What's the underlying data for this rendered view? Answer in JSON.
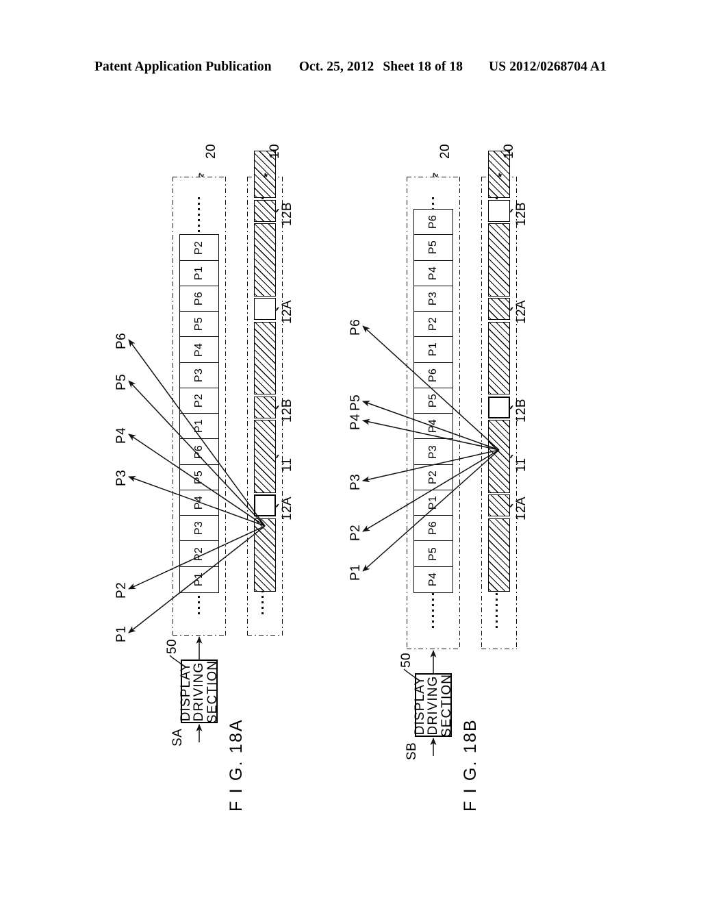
{
  "header": {
    "left": "Patent Application Publication",
    "date": "Oct. 25, 2012",
    "sheet": "Sheet 18 of 18",
    "patent_number": "US 2012/0268704 A1"
  },
  "figures": [
    {
      "id": "fig-18a",
      "name": "F I G.  18A",
      "input_signal": "SA",
      "driving_section": {
        "ref": "50",
        "line1": "DISPLAY",
        "line2": "DRIVING",
        "line3": "SECTION"
      },
      "display_panel": {
        "ref": "20",
        "cells": [
          "P1",
          "P2",
          "P3",
          "P4",
          "P5",
          "P6",
          "P1",
          "P2",
          "P3",
          "P4",
          "P5",
          "P6",
          "P1",
          "P2"
        ]
      },
      "barrier": {
        "ref": "10",
        "shield_ref": "11",
        "aperture_a_ref": "12A",
        "aperture_b_ref": "12B",
        "segments": [
          {
            "kind": "shield",
            "span": 3,
            "label": "11"
          },
          {
            "kind": "open",
            "span": 1,
            "label": "12A",
            "focus": true
          },
          {
            "kind": "shield",
            "span": 3,
            "label": "11"
          },
          {
            "kind": "hatch-small",
            "span": 1,
            "label": "12B"
          },
          {
            "kind": "shield",
            "span": 3,
            "label": "11"
          },
          {
            "kind": "open",
            "span": 1,
            "label": "12A"
          },
          {
            "kind": "shield",
            "span": 3,
            "label": "11"
          },
          {
            "kind": "hatch-small",
            "span": 1,
            "label": "12B"
          },
          {
            "kind": "shield",
            "span": 2,
            "label": "11"
          }
        ]
      },
      "callouts": [
        "P1",
        "P2",
        "P3",
        "P4",
        "P5",
        "P6"
      ]
    },
    {
      "id": "fig-18b",
      "name": "F I G.  18B",
      "input_signal": "SB",
      "driving_section": {
        "ref": "50",
        "line1": "DISPLAY",
        "line2": "DRIVING",
        "line3": "SECTION"
      },
      "display_panel": {
        "ref": "20",
        "cells": [
          "P4",
          "P5",
          "P6",
          "P1",
          "P2",
          "P3",
          "P4",
          "P5",
          "P6",
          "P1",
          "P2",
          "P3",
          "P4",
          "P5",
          "P6"
        ]
      },
      "barrier": {
        "ref": "10",
        "shield_ref": "11",
        "aperture_a_ref": "12A",
        "aperture_b_ref": "12B",
        "segments": [
          {
            "kind": "shield",
            "span": 3,
            "label": "11"
          },
          {
            "kind": "hatch-small",
            "span": 1,
            "label": "12A"
          },
          {
            "kind": "shield",
            "span": 3,
            "label": "11"
          },
          {
            "kind": "open",
            "span": 1,
            "label": "12B",
            "focus": true
          },
          {
            "kind": "shield",
            "span": 3,
            "label": "11"
          },
          {
            "kind": "hatch-small",
            "span": 1,
            "label": "12A"
          },
          {
            "kind": "shield",
            "span": 3,
            "label": "11"
          },
          {
            "kind": "open",
            "span": 1,
            "label": "12B"
          },
          {
            "kind": "shield",
            "span": 2,
            "label": "11"
          }
        ]
      },
      "callouts": [
        "P1",
        "P2",
        "P3",
        "P4",
        "P5",
        "P6"
      ]
    }
  ],
  "colors": {
    "ink": "#000000",
    "paper": "#ffffff"
  }
}
